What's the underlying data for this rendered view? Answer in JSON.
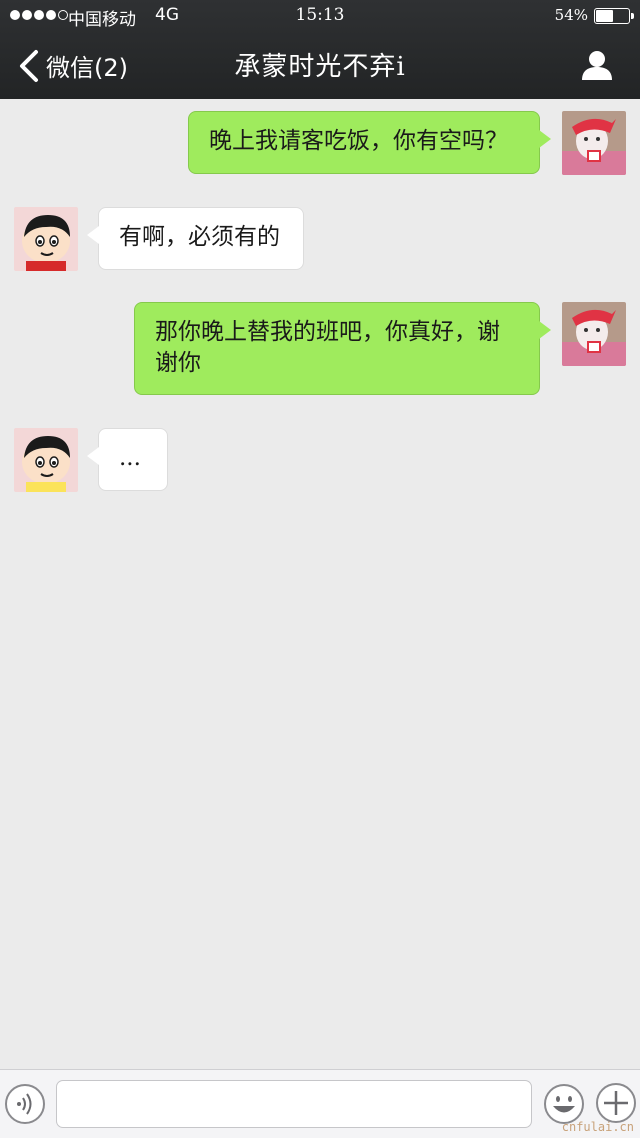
{
  "status_bar": {
    "carrier": "中国移动",
    "network": "4G",
    "time": "15:13",
    "battery_percent_text": "54%",
    "battery_level": 0.54
  },
  "nav": {
    "back_label": "微信(2)",
    "title": "承蒙时光不弃i"
  },
  "messages": [
    {
      "side": "out",
      "text": "晚上我请客吃饭，你有空吗？"
    },
    {
      "side": "in",
      "text": "有啊，必须有的"
    },
    {
      "side": "out",
      "text": "那你晚上替我的班吧，你真好，谢谢你"
    },
    {
      "side": "in",
      "text": "..."
    }
  ],
  "watermark": "cnfulai.cn",
  "colors": {
    "header": "#2a2c2e",
    "outgoing_bubble": "#9feb5d",
    "incoming_bubble": "#ffffff",
    "background": "#ebebeb"
  }
}
